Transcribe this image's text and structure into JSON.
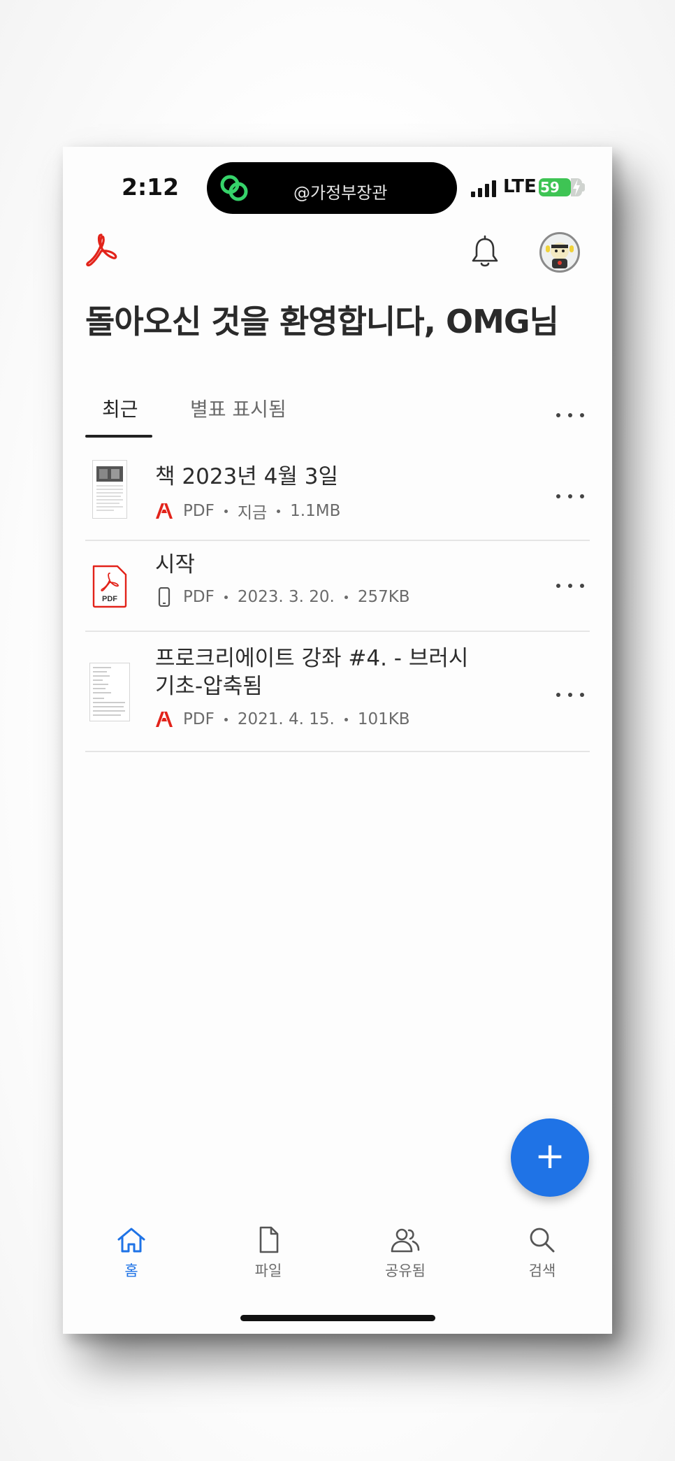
{
  "status_bar": {
    "time": "2:12",
    "island_text": "@가정부장관",
    "network": "LTE",
    "battery": "59"
  },
  "header": {
    "welcome": "돌아오신 것을 환영합니다, OMG님"
  },
  "tabs": [
    {
      "label": "최근",
      "active": true
    },
    {
      "label": "별표 표시됨",
      "active": false
    }
  ],
  "files": [
    {
      "name_lines": [
        "책 2023년 4월 3일"
      ],
      "type": "PDF",
      "date": "지금",
      "size": "1.1MB",
      "source_icon": "acrobat-cloud-icon"
    },
    {
      "name_lines": [
        "시작"
      ],
      "type": "PDF",
      "date": "2023. 3. 20.",
      "size": "257KB",
      "source_icon": "phone-device-icon"
    },
    {
      "name_lines": [
        "프로크리에이트 강좌 #4.  -  브러시",
        "기초-압축됨"
      ],
      "type": "PDF",
      "date": "2021. 4. 15.",
      "size": "101KB",
      "source_icon": "acrobat-cloud-icon"
    }
  ],
  "fab": {
    "label": "+"
  },
  "nav": [
    {
      "label": "홈",
      "icon": "home-icon",
      "active": true
    },
    {
      "label": "파일",
      "icon": "file-icon",
      "active": false
    },
    {
      "label": "공유됨",
      "icon": "people-icon",
      "active": false
    },
    {
      "label": "검색",
      "icon": "search-icon",
      "active": false
    }
  ],
  "colors": {
    "accent": "#1f73e6",
    "acrobat_red": "#e2231a",
    "battery_green": "#3ec454"
  }
}
